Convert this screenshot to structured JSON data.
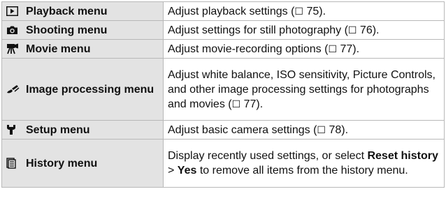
{
  "rows": [
    {
      "icon": "playback-icon",
      "name": "Playback menu",
      "desc": {
        "text": "Adjust playback settings (",
        "ref": "\u0000",
        "page": "75",
        "end": ")."
      }
    },
    {
      "icon": "camera-icon",
      "name": "Shooting menu",
      "desc": {
        "text": "Adjust settings for still photography (",
        "page": "76",
        "end": ")."
      }
    },
    {
      "icon": "movie-camera-icon",
      "name": "Movie menu",
      "desc": {
        "text": "Adjust movie-recording options (",
        "page": "77",
        "end": ")."
      }
    },
    {
      "icon": "brush-icon",
      "name": "Image processing menu",
      "desc": {
        "text": "Adjust white balance, ISO sensitivity, Picture Controls, and other image processing settings for photographs and movies (",
        "page": "77",
        "end": ")."
      }
    },
    {
      "icon": "wrench-icon",
      "name": "Setup menu",
      "desc": {
        "text": "Adjust basic camera settings (",
        "page": "78",
        "end": ")."
      }
    },
    {
      "icon": "history-icon",
      "name": "History menu",
      "desc": {
        "part1": "Display recently used settings, or select ",
        "bold1": "Reset history",
        "part2": " > ",
        "bold2": "Yes",
        "part3": " to remove all items from the history menu."
      }
    }
  ],
  "ref_symbol": "☐"
}
